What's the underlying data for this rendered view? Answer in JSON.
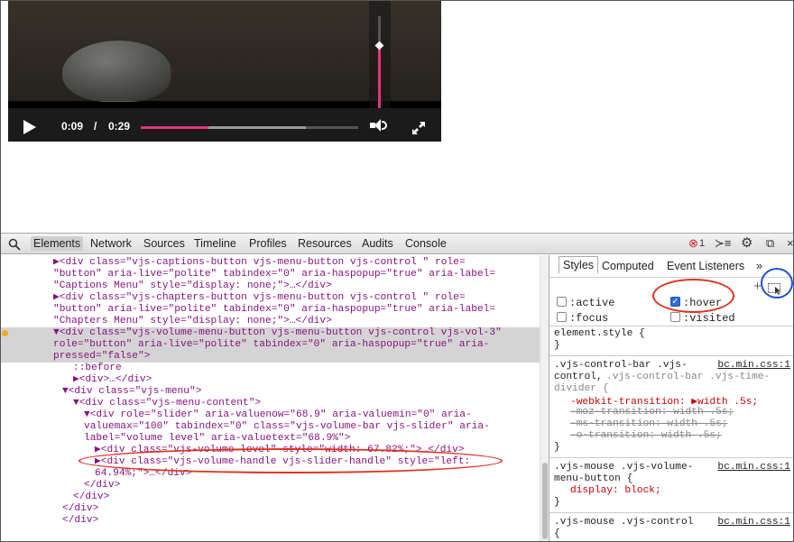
{
  "player": {
    "current_time": "0:09",
    "divider": "/",
    "duration": "0:29",
    "progress_fraction": 0.31,
    "buffered_fraction": 0.76,
    "volume_fraction": 0.68
  },
  "devtools": {
    "tabs": [
      "Elements",
      "Network",
      "Sources",
      "Timeline",
      "Profiles",
      "Resources",
      "Audits",
      "Console"
    ],
    "error_count": "1",
    "styles_tabs": [
      "Styles",
      "Computed",
      "Event Listeners"
    ],
    "more_tabs": "»",
    "pseudo": {
      "active": ":active",
      "hover": ":hover",
      "focus": ":focus",
      "visited": ":visited"
    }
  },
  "dom_lines": [
    "▶<div class=\"vjs-captions-button vjs-menu-button vjs-control \" role=",
    "\"button\" aria-live=\"polite\" tabindex=\"0\" aria-haspopup=\"true\" aria-label=",
    "\"Captions Menu\" style=\"display: none;\">…</div>",
    "▶<div class=\"vjs-chapters-button vjs-menu-button vjs-control \" role=",
    "\"button\" aria-live=\"polite\" tabindex=\"0\" aria-haspopup=\"true\" aria-label=",
    "\"Chapters Menu\" style=\"display: none;\">…</div>",
    "▼<div class=\"vjs-volume-menu-button vjs-menu-button vjs-control vjs-vol-3\"",
    "role=\"button\" aria-live=\"polite\" tabindex=\"0\" aria-haspopup=\"true\" aria-",
    "pressed=\"false\">",
    "::before",
    "▶<div>…</div>",
    "▼<div class=\"vjs-menu\">",
    "▼<div class=\"vjs-menu-content\">",
    "▼<div role=\"slider\" aria-valuenow=\"68.9\" aria-valuemin=\"0\" aria-",
    "valuemax=\"100\" tabindex=\"0\" class=\"vjs-volume-bar vjs-slider\" aria-",
    "label=\"volume level\" aria-valuetext=\"68.9%\">",
    "▶<div class=\"vjs-volume-level\" style=\"width: 67.82%;\">…</div>",
    "▶<div class=\"vjs-volume-handle vjs-slider-handle\" style=\"left:",
    "64.94%;\">…</div>",
    "</div>",
    "</div>",
    "</div>",
    "</div>"
  ],
  "styles": {
    "element_style": "element.style {",
    "close": "}",
    "rule1_selector_a": ".vjs-control-bar .vjs-",
    "rule1_selector_b": "control,",
    "rule1_selector_c": ".vjs-control-bar .vjs-time-",
    "rule1_selector_d": "divider {",
    "rule1_source": "bc.min.css:1",
    "rule1_props": [
      "-webkit-transition: ▶width .5s;",
      "-moz-transition: width .5s;",
      "-ms-transition: width .5s;",
      "-o-transition: width .5s;"
    ],
    "rule2_selector_a": ".vjs-mouse .vjs-volume-",
    "rule2_selector_b": "menu-button {",
    "rule2_source": "bc.min.css:1",
    "rule2_prop": "display: block;",
    "rule3_selector": ".vjs-mouse .vjs-control",
    "rule3_source": "bc.min.css:1",
    "rule3_open": "{"
  },
  "colors": {
    "accent_pink": "#e6327a",
    "annotation_red": "#e0301e",
    "annotation_blue": "#1f4fd6"
  }
}
